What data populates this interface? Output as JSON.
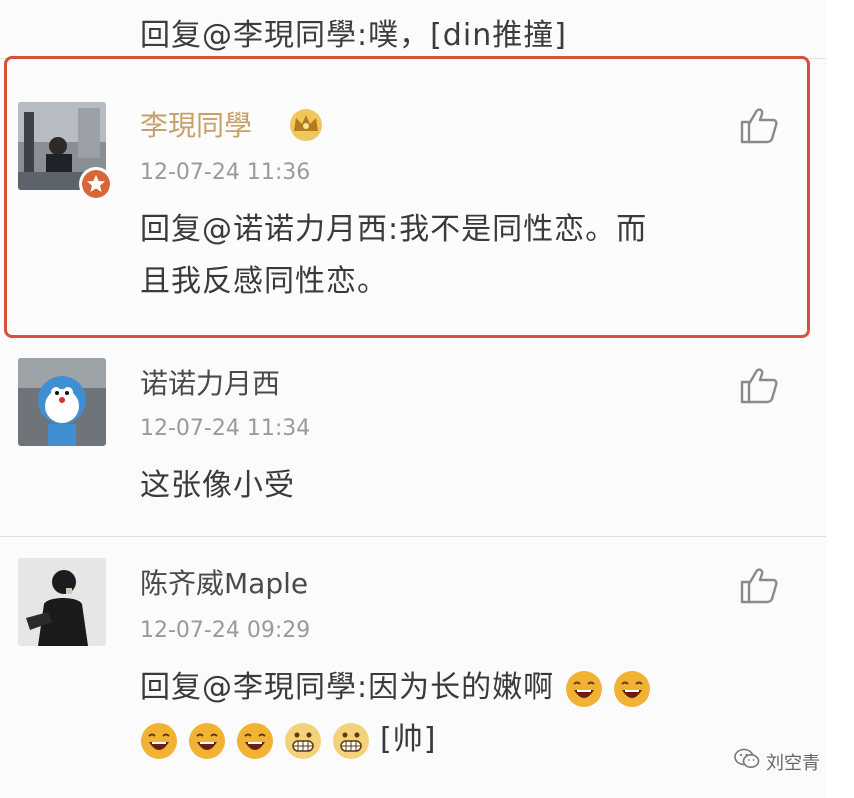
{
  "top_comment": {
    "text": "回复@李現同學:噗，[din推撞]"
  },
  "comments": [
    {
      "name": "李現同學",
      "time": "12-07-24 11:36",
      "text_line1": "回复@诺诺力月西:我不是同性恋。而",
      "text_line2": "且我反感同性恋。",
      "highlighted": true,
      "name_color": "#c8a069"
    },
    {
      "name": "诺诺力月西",
      "time": "12-07-24 11:34",
      "text_line1": "这张像小受"
    },
    {
      "name": "陈齐威Maple",
      "time": "12-07-24 09:29",
      "text_line1": "回复@李現同學:因为长的嫩啊",
      "text_tail": "[帅]"
    }
  ],
  "watermark": {
    "label": "刘空青"
  },
  "colors": {
    "highlight_border": "#d9503d",
    "vip_badge": "#d9663a",
    "emoji_face": "#f2b233"
  }
}
